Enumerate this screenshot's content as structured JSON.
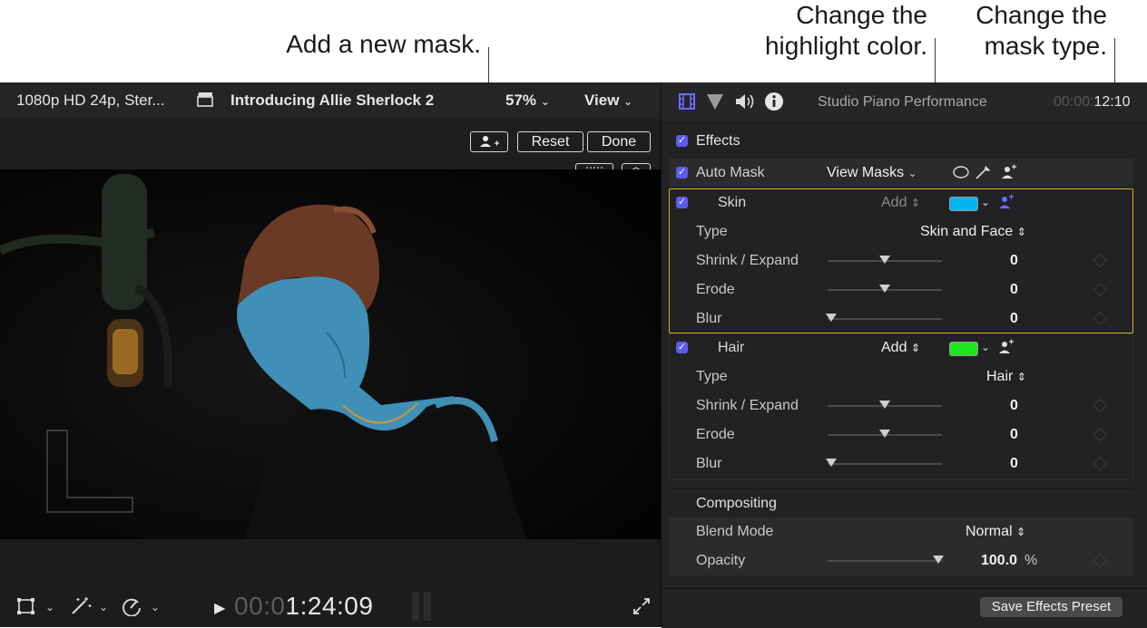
{
  "callouts": {
    "add_mask": "Add a new mask.",
    "highlight_line1": "Change the",
    "highlight_line2": "highlight color.",
    "mask_type_line1": "Change the",
    "mask_type_line2": "mask type."
  },
  "viewer": {
    "format": "1080p HD 24p, Ster...",
    "project": "Introducing Allie Sherlock 2",
    "zoom": "57%",
    "view": "View",
    "reset": "Reset",
    "done": "Done",
    "timecode_dim": "00:0",
    "timecode": "1:24:09"
  },
  "inspector": {
    "clip_title": "Studio Piano Performance",
    "duration_dim": "00:00:",
    "duration": "12:10",
    "effects_label": "Effects",
    "auto_mask_label": "Auto Mask",
    "view_masks": "View Masks",
    "skin": {
      "name": "Skin",
      "mode": "Add",
      "color": "#00b4f0",
      "type_label": "Type",
      "type_value": "Skin and Face",
      "shrink_label": "Shrink / Expand",
      "shrink_value": "0",
      "erode_label": "Erode",
      "erode_value": "0",
      "blur_label": "Blur",
      "blur_value": "0"
    },
    "hair": {
      "name": "Hair",
      "mode": "Add",
      "color": "#1fe61f",
      "type_label": "Type",
      "type_value": "Hair",
      "shrink_label": "Shrink / Expand",
      "shrink_value": "0",
      "erode_label": "Erode",
      "erode_value": "0",
      "blur_label": "Blur",
      "blur_value": "0"
    },
    "compositing_label": "Compositing",
    "blend_mode_label": "Blend Mode",
    "blend_mode_value": "Normal",
    "opacity_label": "Opacity",
    "opacity_value": "100.0",
    "opacity_unit": "%",
    "save_preset": "Save Effects Preset"
  },
  "colors": {
    "accent": "#5b5cf0",
    "highlight_outline": "#d7b11a"
  }
}
